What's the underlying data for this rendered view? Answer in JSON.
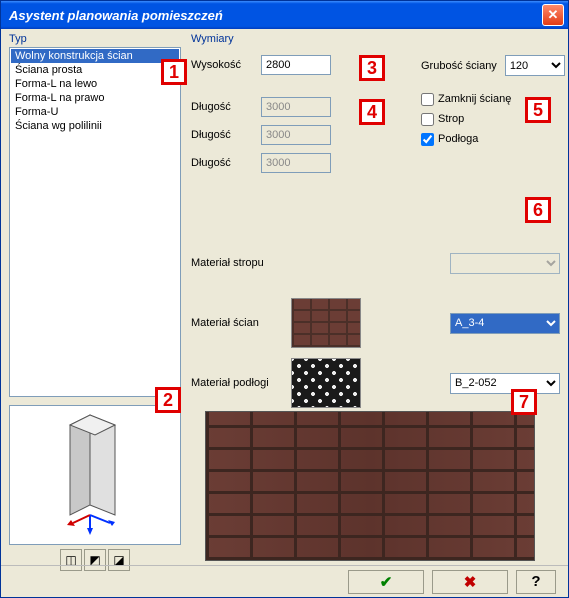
{
  "window": {
    "title": "Asystent planowania pomieszczeń"
  },
  "typ": {
    "label": "Typ",
    "items": [
      "Wolny konstrukcja ścian",
      "Ściana prosta",
      "Forma-L na lewo",
      "Forma-L na prawo",
      "Forma-U",
      "Ściana wg polilinii"
    ],
    "selected_index": 0
  },
  "wymiary": {
    "label": "Wymiary",
    "height_label": "Wysokość",
    "height_value": "2800",
    "length_label": "Długość",
    "length_values": [
      "3000",
      "3000",
      "3000"
    ],
    "thickness_label": "Grubość ściany",
    "thickness_value": "120"
  },
  "options": {
    "close_wall": {
      "label": "Zamknij ścianę",
      "checked": false
    },
    "ceiling": {
      "label": "Strop",
      "checked": false
    },
    "floor": {
      "label": "Podłoga",
      "checked": true
    }
  },
  "materials": {
    "ceiling_label": "Materiał stropu",
    "ceiling_value": "",
    "wall_label": "Materiał ścian",
    "wall_value": "A_3-4",
    "floor_label": "Materiał podłogi",
    "floor_value": "B_2-052"
  },
  "markers": {
    "m1": "1",
    "m2": "2",
    "m3": "3",
    "m4": "4",
    "m5": "5",
    "m6": "6",
    "m7": "7"
  },
  "footer": {
    "ok_glyph": "✔",
    "cancel_glyph": "✖",
    "help_glyph": "?"
  }
}
